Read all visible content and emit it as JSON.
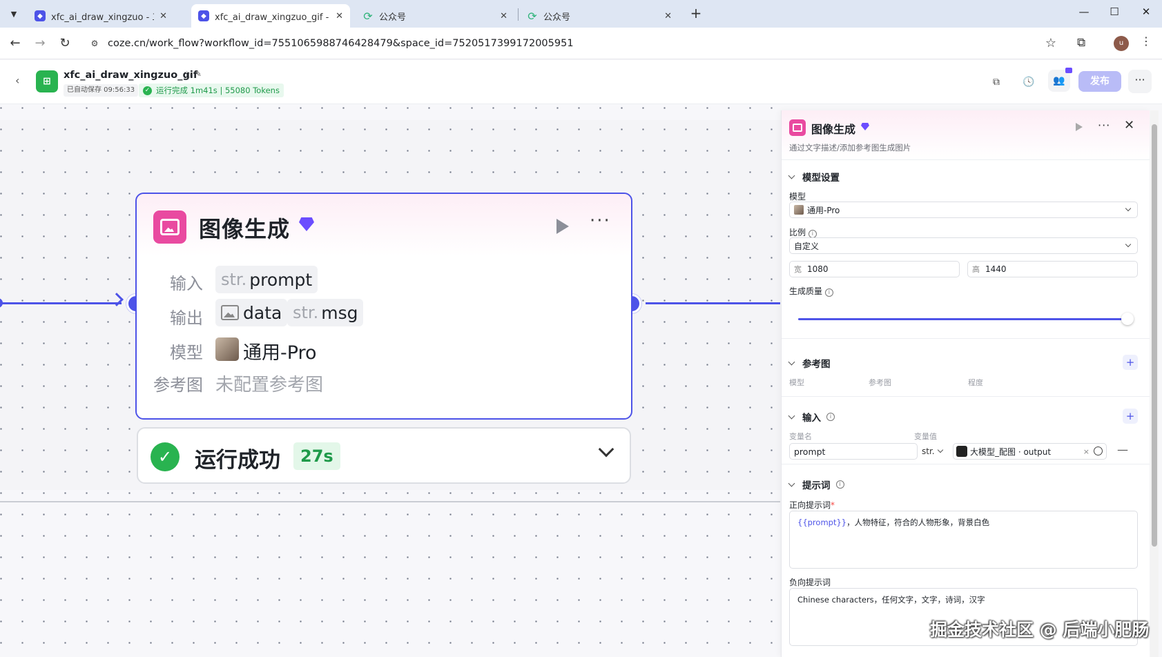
{
  "browser": {
    "tabs": [
      {
        "title": "xfc_ai_draw_xingzuo - 工作流",
        "icon": "coze-icon",
        "active": false
      },
      {
        "title": "xfc_ai_draw_xingzuo_gif - 工作流",
        "icon": "coze-icon",
        "active": true
      },
      {
        "title": "公众号",
        "icon": "wechat-icon",
        "active": false
      },
      {
        "title": "公众号",
        "icon": "wechat-icon",
        "active": false
      }
    ],
    "url": "coze.cn/work_flow?workflow_id=7551065988746428479&space_id=7520517399172005951",
    "profile_initial": "u"
  },
  "header": {
    "app_title": "xfc_ai_draw_xingzuo_gif",
    "autosave": "已自动保存 09:56:33",
    "run_status": "运行完成 1m41s | 55080 Tokens",
    "publish_label": "发布"
  },
  "node": {
    "title": "图像生成",
    "input_label": "输入",
    "input_type": "str.",
    "input_name": "prompt",
    "output_label": "输出",
    "output_1": "data",
    "output_2_type": "str.",
    "output_2": "msg",
    "model_label": "模型",
    "model_name": "通用-Pro",
    "ref_label": "参考图",
    "ref_value": "未配置参考图"
  },
  "run_result": {
    "status": "运行成功",
    "duration": "27s"
  },
  "panel": {
    "title": "图像生成",
    "description": "通过文字描述/添加参考图生成图片",
    "model_section": "模型设置",
    "model_label": "模型",
    "model_value": "通用-Pro",
    "ratio_label": "比例",
    "ratio_value": "自定义",
    "width_prefix": "宽",
    "width_value": "1080",
    "height_prefix": "高",
    "height_value": "1440",
    "quality_label": "生成质量",
    "quality_level": 1.0,
    "ref_section": "参考图",
    "ref_col_model": "模型",
    "ref_col_image": "参考图",
    "ref_col_degree": "程度",
    "input_section": "输入",
    "var_name_label": "变量名",
    "var_value_label": "变量值",
    "var_name": "prompt",
    "var_type": "str.",
    "var_ref": "大模型_配图 · output",
    "prompt_section": "提示词",
    "positive_label": "正向提示词",
    "positive_var": "{{prompt}}",
    "positive_text": "，人物特征，符合的人物形象，背景白色",
    "negative_label": "负向提示词",
    "negative_text": "Chinese characters，任何文字，文字，诗词，汉字"
  },
  "watermark": "掘金技术社区 @ 后端小肥肠",
  "colors": {
    "accent": "#4d53e8",
    "node_icon": "#e94aa0",
    "success": "#29b350",
    "vip": "#6b4dff"
  }
}
